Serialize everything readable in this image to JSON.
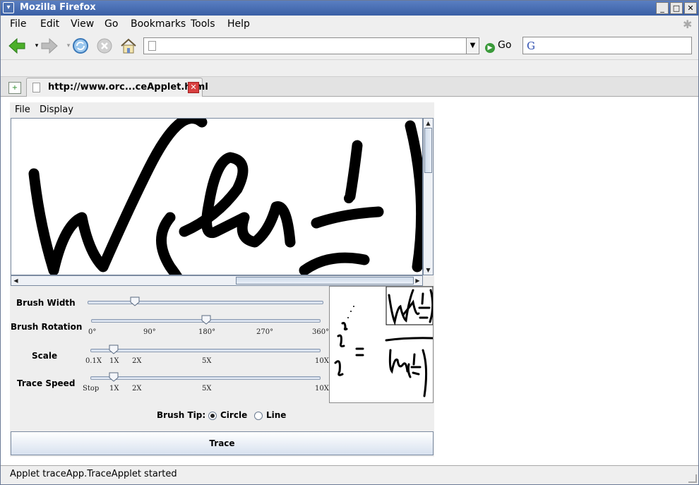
{
  "window": {
    "title": "Mozilla Firefox",
    "controls": [
      "minimize-icon",
      "maximize-icon",
      "close-icon"
    ]
  },
  "menubar": {
    "items": [
      "File",
      "Edit",
      "View",
      "Go",
      "Bookmarks",
      "Tools",
      "Help"
    ]
  },
  "navigation": {
    "back": "back-arrow-icon",
    "forward": "forward-arrow-icon",
    "reload": "reload-icon",
    "stop": "stop-icon",
    "home": "home-icon",
    "url_value": "",
    "go_label": "Go",
    "search_value": ""
  },
  "tabs": [
    {
      "label": "http://www.orc...ceApplet.html",
      "active": true
    }
  ],
  "applet": {
    "menu": [
      "File",
      "Display"
    ],
    "controls": {
      "brush_width": {
        "label": "Brush Width",
        "value_fraction": 0.2
      },
      "brush_rotation": {
        "label": "Brush Rotation",
        "ticks": [
          "0°",
          "90°",
          "180°",
          "270°",
          "360°"
        ],
        "value": "180°"
      },
      "scale": {
        "label": "Scale",
        "ticks": [
          "0.1X",
          "1X",
          "2X",
          "5X",
          "10X"
        ],
        "value": "1X"
      },
      "trace_speed": {
        "label": "Trace Speed",
        "ticks": [
          "Stop",
          "1X",
          "2X",
          "5X",
          "10X"
        ],
        "value": "1X"
      }
    },
    "brush_tip": {
      "label": "Brush Tip:",
      "options": [
        "Circle",
        "Line"
      ],
      "selected": "Circle"
    },
    "trace_button": "Trace"
  },
  "status": {
    "text": "Applet traceApp.TraceApplet started"
  },
  "colors": {
    "titlebar": "#4a6fb0",
    "accent": "#d7e1ef"
  }
}
